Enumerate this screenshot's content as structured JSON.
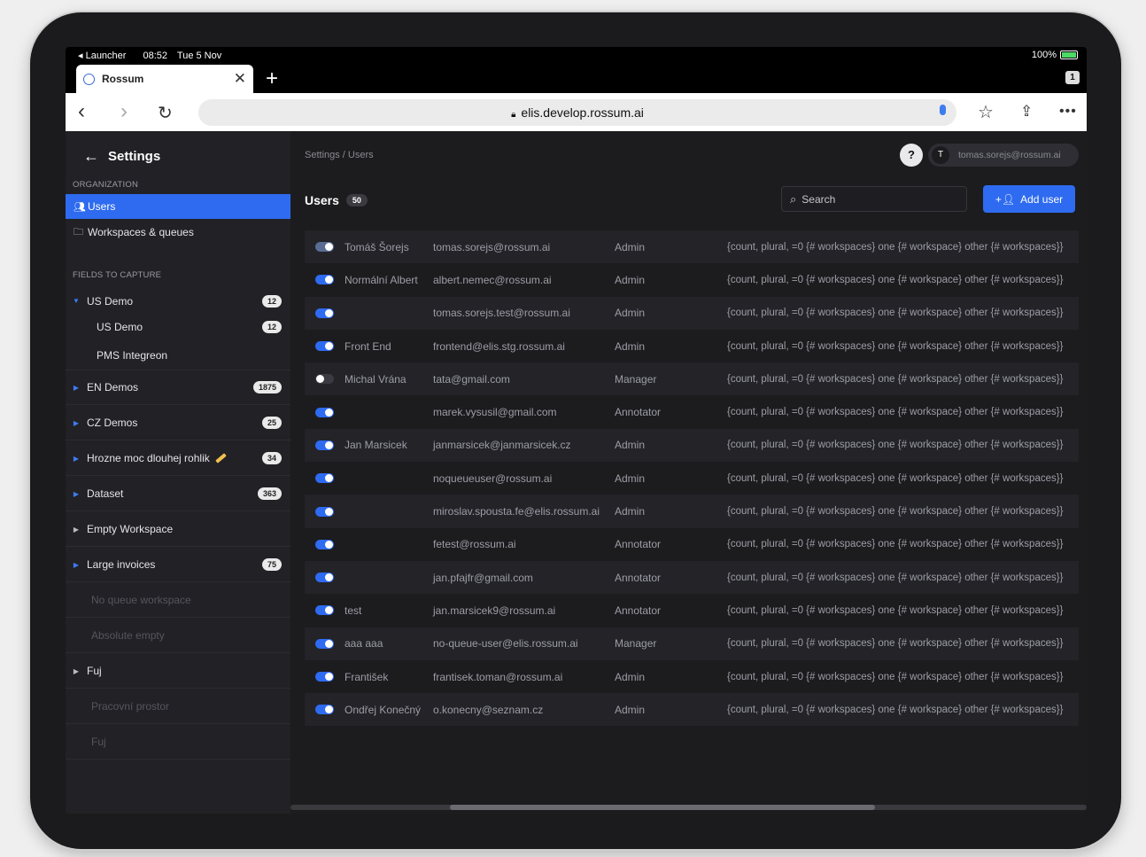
{
  "status": {
    "app": "Launcher",
    "time": "08:52",
    "date": "Tue 5 Nov",
    "battery": "100%"
  },
  "browser": {
    "tab_title": "Rossum",
    "tab_count": "1",
    "url": "elis.develop.rossum.ai"
  },
  "sidebar": {
    "title": "Settings",
    "org_section": "ORGANIZATION",
    "org_items": [
      {
        "label": "Users",
        "icon": "users-icon",
        "active": true
      },
      {
        "label": "Workspaces & queues",
        "icon": "folder-icon",
        "active": false
      }
    ],
    "fields_section": "FIELDS TO CAPTURE",
    "tree": [
      {
        "label": "US Demo",
        "count": "12",
        "expanded": true
      },
      {
        "label": "US Demo",
        "count": "12",
        "child": true
      },
      {
        "label": "PMS Integreon",
        "count": "",
        "child": true
      },
      {
        "label": "EN Demos",
        "count": "1875"
      },
      {
        "label": "CZ Demos",
        "count": "25"
      },
      {
        "label": "Hrozne moc dlouhej rohlik",
        "count": "34"
      },
      {
        "label": "Dataset",
        "count": "363"
      },
      {
        "label": "Empty Workspace",
        "count": ""
      },
      {
        "label": "Large invoices",
        "count": "75"
      },
      {
        "label": "No queue workspace",
        "count": "",
        "muted": true
      },
      {
        "label": "Absolute empty",
        "count": "",
        "muted": true
      },
      {
        "label": "Fuj",
        "count": ""
      },
      {
        "label": "Pracovní prostor",
        "count": "",
        "muted": true
      },
      {
        "label": "Fuj",
        "count": "",
        "muted": true
      }
    ]
  },
  "main": {
    "breadcrumb": "Settings / Users",
    "help": "?",
    "user_initial": "T",
    "user_email": "tomas.sorejs@rossum.ai",
    "title": "Users",
    "count": "50",
    "search_placeholder": "Search",
    "add_user": "Add user",
    "workspaces_text": "{count, plural, =0 {# workspaces} one {# workspace} other {# workspaces}}",
    "users": [
      {
        "name": "Tomáš Šorejs",
        "email": "tomas.sorejs@rossum.ai",
        "role": "Admin",
        "active": "dim"
      },
      {
        "name": "Normální Albert",
        "email": "albert.nemec@rossum.ai",
        "role": "Admin",
        "active": "on"
      },
      {
        "name": "",
        "email": "tomas.sorejs.test@rossum.ai",
        "role": "Admin",
        "active": "on"
      },
      {
        "name": "Front End",
        "email": "frontend@elis.stg.rossum.ai",
        "role": "Admin",
        "active": "on"
      },
      {
        "name": "Michal Vrána",
        "email": "tata@gmail.com",
        "role": "Manager",
        "active": "off"
      },
      {
        "name": "",
        "email": "marek.vysusil@gmail.com",
        "role": "Annotator",
        "active": "on"
      },
      {
        "name": "Jan Marsicek",
        "email": "janmarsicek@janmarsicek.cz",
        "role": "Admin",
        "active": "on"
      },
      {
        "name": "",
        "email": "noqueueuser@rossum.ai",
        "role": "Admin",
        "active": "on"
      },
      {
        "name": "",
        "email": "miroslav.spousta.fe@elis.rossum.ai",
        "role": "Admin",
        "active": "on"
      },
      {
        "name": "",
        "email": "fetest@rossum.ai",
        "role": "Annotator",
        "active": "on"
      },
      {
        "name": "",
        "email": "jan.pfajfr@gmail.com",
        "role": "Annotator",
        "active": "on"
      },
      {
        "name": "test",
        "email": "jan.marsicek9@rossum.ai",
        "role": "Annotator",
        "active": "on"
      },
      {
        "name": "aaa aaa",
        "email": "no-queue-user@elis.rossum.ai",
        "role": "Manager",
        "active": "on"
      },
      {
        "name": "František",
        "email": "frantisek.toman@rossum.ai",
        "role": "Admin",
        "active": "on"
      },
      {
        "name": "Ondřej Konečný",
        "email": "o.konecny@seznam.cz",
        "role": "Admin",
        "active": "on"
      }
    ]
  }
}
